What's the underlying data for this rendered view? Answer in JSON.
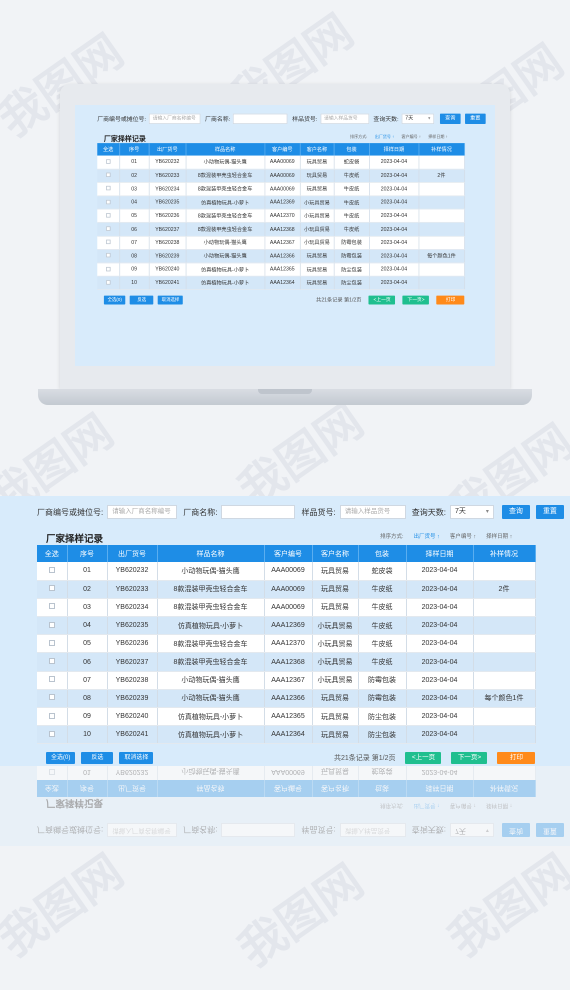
{
  "filter": {
    "vendor_label": "厂商编号或摊位号:",
    "vendor_placeholder": "请输入厂商名称编号",
    "vendor_name_label": "厂商名称:",
    "sample_no_label": "样品货号:",
    "sample_no_placeholder": "请输入样品货号",
    "days_label": "查询天数:",
    "days_value": "7天",
    "query_btn": "查询",
    "reset_btn": "重置"
  },
  "section": {
    "title": "厂家择样记录",
    "sort_label": "排序方式:",
    "sort_vendor": "出厂货号 ↑",
    "sort_customer": "客户编号 ↑",
    "sort_date": "择样日期 ↑"
  },
  "table": {
    "headers": [
      "全选",
      "序号",
      "出厂货号",
      "样品名称",
      "客户编号",
      "客户名称",
      "包装",
      "择样日期",
      "补样情况"
    ],
    "rows": [
      [
        "",
        "01",
        "YB620232",
        "小动物玩偶-猫头鹰",
        "AAA00069",
        "玩具贸易",
        "蛇皮袋",
        "2023-04-04",
        ""
      ],
      [
        "",
        "02",
        "YB620233",
        "8款混装甲壳虫轻合金车",
        "AAA00069",
        "玩具贸易",
        "牛皮纸",
        "2023-04-04",
        "2件"
      ],
      [
        "",
        "03",
        "YB620234",
        "8款混装甲壳虫轻合金车",
        "AAA00069",
        "玩具贸易",
        "牛皮纸",
        "2023-04-04",
        ""
      ],
      [
        "",
        "04",
        "YB620235",
        "仿真植物玩具-小萝卜",
        "AAA12369",
        "小玩具贸易",
        "牛皮纸",
        "2023-04-04",
        ""
      ],
      [
        "",
        "05",
        "YB620236",
        "8款混装甲壳虫轻合金车",
        "AAA12370",
        "小玩具贸易",
        "牛皮纸",
        "2023-04-04",
        ""
      ],
      [
        "",
        "06",
        "YB620237",
        "8款混装甲壳虫轻合金车",
        "AAA12368",
        "小玩具贸易",
        "牛皮纸",
        "2023-04-04",
        ""
      ],
      [
        "",
        "07",
        "YB620238",
        "小动物玩偶-猫头鹰",
        "AAA12367",
        "小玩具贸易",
        "防霉包装",
        "2023-04-04",
        ""
      ],
      [
        "",
        "08",
        "YB620239",
        "小动物玩偶-猫头鹰",
        "AAA12366",
        "玩具贸易",
        "防霉包装",
        "2023-04-04",
        "每个颜色1件"
      ],
      [
        "",
        "09",
        "YB620240",
        "仿真植物玩具-小萝卜",
        "AAA12365",
        "玩具贸易",
        "防尘包装",
        "2023-04-04",
        ""
      ],
      [
        "",
        "10",
        "YB620241",
        "仿真植物玩具-小萝卜",
        "AAA12364",
        "玩具贸易",
        "防尘包装",
        "2023-04-04",
        ""
      ]
    ]
  },
  "actions": {
    "select_all": "全选(0)",
    "invert": "反选",
    "cancel": "取消选择"
  },
  "pager": {
    "summary": "共21条记录 第1/2页",
    "prev": "<上一页",
    "next": "下一页>",
    "print": "打印"
  },
  "colors": {
    "primary": "#1e8de6",
    "green": "#1fbf8f",
    "orange": "#ff8a1a",
    "panel_bg": "#d8ebfb",
    "row_alt": "#d4e7f8"
  }
}
